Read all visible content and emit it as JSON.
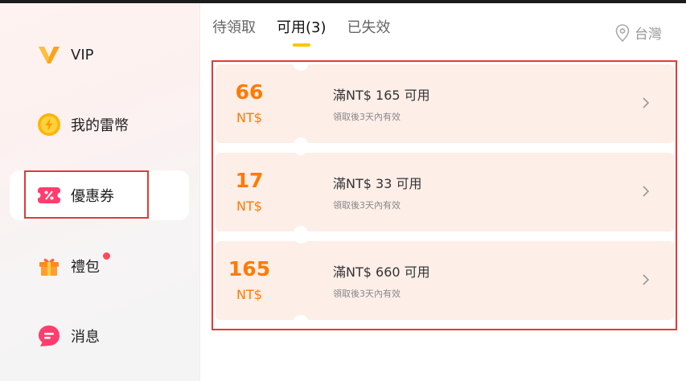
{
  "sidebar": {
    "items": [
      {
        "label": "VIP"
      },
      {
        "label": "我的雷幣"
      },
      {
        "label": "優惠券"
      },
      {
        "label": "禮包"
      },
      {
        "label": "消息"
      }
    ]
  },
  "tabs": [
    {
      "label": "待領取"
    },
    {
      "label": "可用(3)"
    },
    {
      "label": "已失效"
    }
  ],
  "region": {
    "label": "台灣",
    "icon": "location-pin-icon"
  },
  "coupons": [
    {
      "amount": "66",
      "currency": "NT$",
      "condition": "滿NT$ 165 可用",
      "note": "領取後3天內有效"
    },
    {
      "amount": "17",
      "currency": "NT$",
      "condition": "滿NT$ 33 可用",
      "note": "領取後3天內有效"
    },
    {
      "amount": "165",
      "currency": "NT$",
      "condition": "滿NT$ 660 可用",
      "note": "領取後3天內有效"
    }
  ],
  "colors": {
    "accent": "#ff7a00",
    "tab_indicator": "#ffc400",
    "highlight": "#e53935",
    "coupon_bg": "#fdeee8"
  }
}
